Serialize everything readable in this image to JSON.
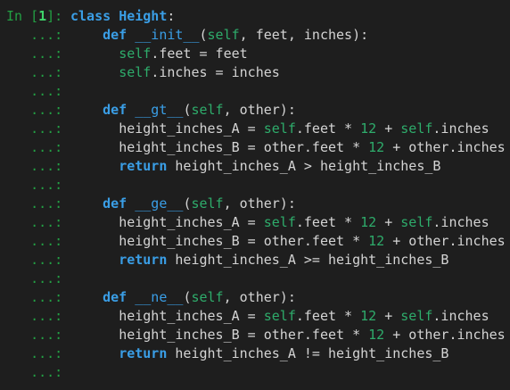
{
  "prompt": {
    "in_prefix": "In [",
    "number": "1",
    "in_suffix": "]: ",
    "continuation": "   ...: "
  },
  "code_lines": [
    {
      "type": "first",
      "indent": "",
      "tokens": [
        {
          "c": "kw",
          "t": "class "
        },
        {
          "c": "cls",
          "t": "Height"
        },
        {
          "c": "op",
          "t": ":"
        }
      ]
    },
    {
      "type": "cont",
      "indent": "    ",
      "tokens": [
        {
          "c": "kw",
          "t": "def "
        },
        {
          "c": "fn",
          "t": "__init__"
        },
        {
          "c": "op",
          "t": "("
        },
        {
          "c": "slf",
          "t": "self"
        },
        {
          "c": "op",
          "t": ", feet, inches):"
        }
      ]
    },
    {
      "type": "cont",
      "indent": "      ",
      "tokens": [
        {
          "c": "slf",
          "t": "self"
        },
        {
          "c": "op",
          "t": ".feet = feet"
        }
      ]
    },
    {
      "type": "cont",
      "indent": "      ",
      "tokens": [
        {
          "c": "slf",
          "t": "self"
        },
        {
          "c": "op",
          "t": ".inches = inches"
        }
      ]
    },
    {
      "type": "cont",
      "indent": "",
      "tokens": []
    },
    {
      "type": "cont",
      "indent": "    ",
      "tokens": [
        {
          "c": "kw",
          "t": "def "
        },
        {
          "c": "fn",
          "t": "__gt__"
        },
        {
          "c": "op",
          "t": "("
        },
        {
          "c": "slf",
          "t": "self"
        },
        {
          "c": "op",
          "t": ", other):"
        }
      ]
    },
    {
      "type": "cont",
      "indent": "      ",
      "tokens": [
        {
          "c": "op",
          "t": "height_inches_A = "
        },
        {
          "c": "slf",
          "t": "self"
        },
        {
          "c": "op",
          "t": ".feet * "
        },
        {
          "c": "nm",
          "t": "12"
        },
        {
          "c": "op",
          "t": " + "
        },
        {
          "c": "slf",
          "t": "self"
        },
        {
          "c": "op",
          "t": ".inches"
        }
      ]
    },
    {
      "type": "cont",
      "indent": "      ",
      "tokens": [
        {
          "c": "op",
          "t": "height_inches_B = other.feet * "
        },
        {
          "c": "nm",
          "t": "12"
        },
        {
          "c": "op",
          "t": " + other.inches"
        }
      ]
    },
    {
      "type": "cont",
      "indent": "      ",
      "tokens": [
        {
          "c": "kw",
          "t": "return "
        },
        {
          "c": "op",
          "t": "height_inches_A > height_inches_B"
        }
      ]
    },
    {
      "type": "cont",
      "indent": "",
      "tokens": []
    },
    {
      "type": "cont",
      "indent": "    ",
      "tokens": [
        {
          "c": "kw",
          "t": "def "
        },
        {
          "c": "fn",
          "t": "__ge__"
        },
        {
          "c": "op",
          "t": "("
        },
        {
          "c": "slf",
          "t": "self"
        },
        {
          "c": "op",
          "t": ", other):"
        }
      ]
    },
    {
      "type": "cont",
      "indent": "      ",
      "tokens": [
        {
          "c": "op",
          "t": "height_inches_A = "
        },
        {
          "c": "slf",
          "t": "self"
        },
        {
          "c": "op",
          "t": ".feet * "
        },
        {
          "c": "nm",
          "t": "12"
        },
        {
          "c": "op",
          "t": " + "
        },
        {
          "c": "slf",
          "t": "self"
        },
        {
          "c": "op",
          "t": ".inches"
        }
      ]
    },
    {
      "type": "cont",
      "indent": "      ",
      "tokens": [
        {
          "c": "op",
          "t": "height_inches_B = other.feet * "
        },
        {
          "c": "nm",
          "t": "12"
        },
        {
          "c": "op",
          "t": " + other.inches"
        }
      ]
    },
    {
      "type": "cont",
      "indent": "      ",
      "tokens": [
        {
          "c": "kw",
          "t": "return "
        },
        {
          "c": "op",
          "t": "height_inches_A >= height_inches_B"
        }
      ]
    },
    {
      "type": "cont",
      "indent": "",
      "tokens": []
    },
    {
      "type": "cont",
      "indent": "    ",
      "tokens": [
        {
          "c": "kw",
          "t": "def "
        },
        {
          "c": "fn",
          "t": "__ne__"
        },
        {
          "c": "op",
          "t": "("
        },
        {
          "c": "slf",
          "t": "self"
        },
        {
          "c": "op",
          "t": ", other):"
        }
      ]
    },
    {
      "type": "cont",
      "indent": "      ",
      "tokens": [
        {
          "c": "op",
          "t": "height_inches_A = "
        },
        {
          "c": "slf",
          "t": "self"
        },
        {
          "c": "op",
          "t": ".feet * "
        },
        {
          "c": "nm",
          "t": "12"
        },
        {
          "c": "op",
          "t": " + "
        },
        {
          "c": "slf",
          "t": "self"
        },
        {
          "c": "op",
          "t": ".inches"
        }
      ]
    },
    {
      "type": "cont",
      "indent": "      ",
      "tokens": [
        {
          "c": "op",
          "t": "height_inches_B = other.feet * "
        },
        {
          "c": "nm",
          "t": "12"
        },
        {
          "c": "op",
          "t": " + other.inches"
        }
      ]
    },
    {
      "type": "cont",
      "indent": "      ",
      "tokens": [
        {
          "c": "kw",
          "t": "return "
        },
        {
          "c": "op",
          "t": "height_inches_A != height_inches_B"
        }
      ]
    },
    {
      "type": "cont",
      "indent": "",
      "tokens": []
    }
  ],
  "colors": {
    "background": "#1e1e1e",
    "prompt": "#23a044",
    "keyword": "#3a9ee6",
    "self_and_numbers": "#2eac6b",
    "text": "#d4d4d4"
  }
}
